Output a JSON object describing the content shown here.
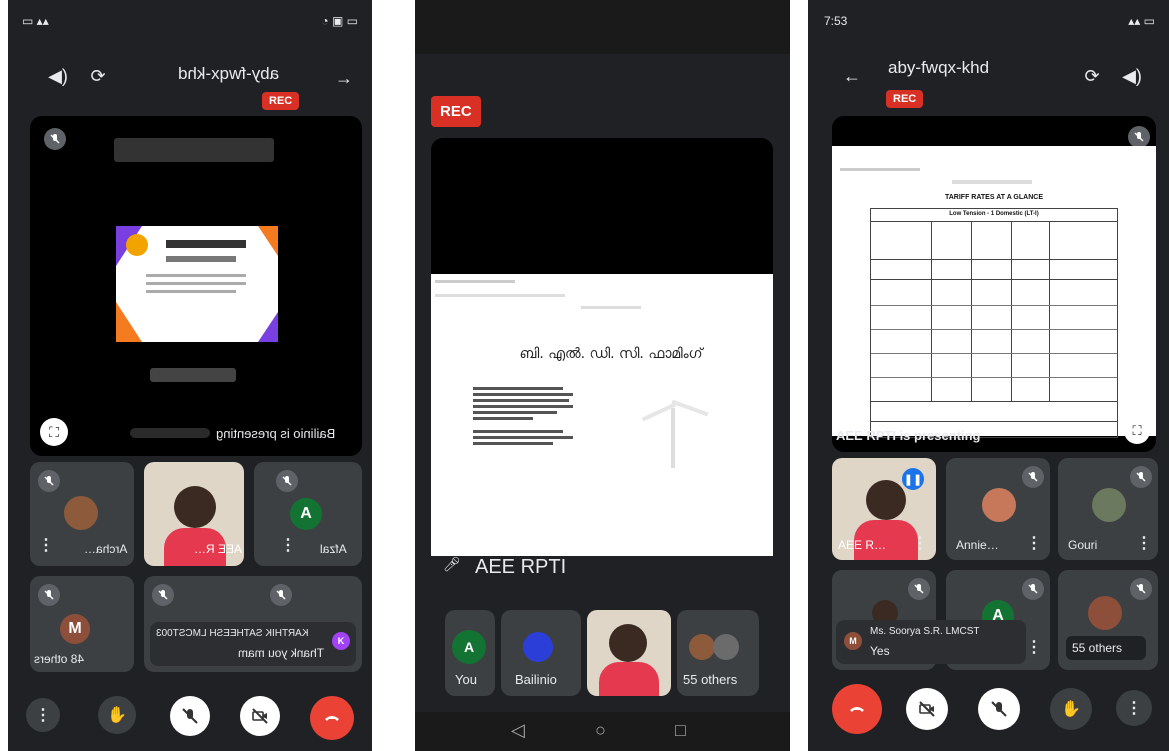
{
  "phone1": {
    "meeting_code": "aby-fwqx-khd",
    "rec": "REC",
    "presenting": "Bailinio is presenting",
    "participants": [
      {
        "name": "Archa…",
        "initial": ""
      },
      {
        "name": "AEE R…",
        "initial": ""
      },
      {
        "name": "Afzal",
        "initial": "A"
      },
      {
        "name": "48 others",
        "initial": "M"
      }
    ],
    "chat_sender": "KARTHIK SATHEESH LMCST003",
    "chat_message": "Thank you mam",
    "chat_initial": "K"
  },
  "phone2": {
    "rec": "REC",
    "presenter_name": "AEE RPTI",
    "slide_title": "ബി. എൽ. ഡി. സി. ഫാമിംഗ്",
    "participants": [
      {
        "name": "You",
        "initial": "A"
      },
      {
        "name": "Bailinio",
        "initial": ""
      },
      {
        "name": "",
        "initial": ""
      },
      {
        "name": "55 others",
        "initial": ""
      }
    ]
  },
  "phone3": {
    "status_time": "7:53",
    "meeting_code": "aby-fwqx-khd",
    "rec": "REC",
    "presenting": "AEE RPTI is presenting",
    "doc_title": "TARIFF RATES AT A GLANCE",
    "doc_subtitle": "Low Tension - 1 Domestic (LT-I)",
    "participants": [
      {
        "name": "AEE R…",
        "initial": ""
      },
      {
        "name": "Annie…",
        "initial": ""
      },
      {
        "name": "Gouri",
        "initial": ""
      },
      {
        "name": "",
        "initial": ""
      },
      {
        "name": "",
        "initial": "A"
      },
      {
        "name": "55 others",
        "initial": ""
      }
    ],
    "chat_sender": "Ms. Soorya S.R. LMCST",
    "chat_message": "Yes",
    "chat_initial": "M"
  },
  "colors": {
    "bg": "#202124",
    "tile": "#3c4043",
    "rec": "#d93025",
    "end": "#ea4335",
    "green": "#137333"
  },
  "icons": [
    "mic-off-icon",
    "camera-off-icon",
    "raise-hand-icon",
    "more-icon",
    "end-call-icon",
    "volume-icon",
    "switch-camera-icon",
    "fullscreen-icon"
  ]
}
